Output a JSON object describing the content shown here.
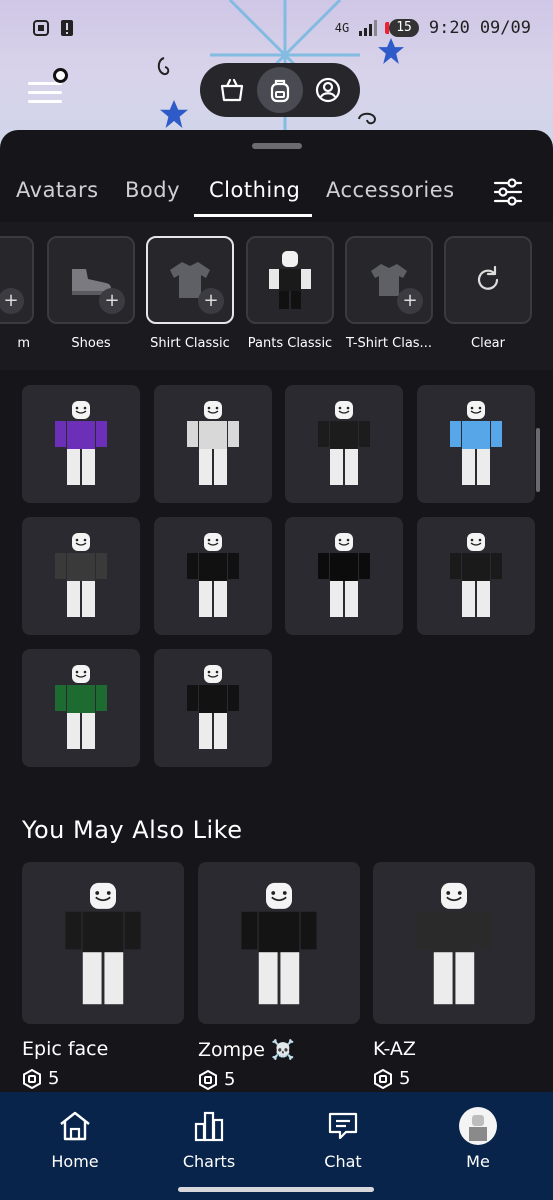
{
  "status": {
    "network": "4G",
    "battery": "15",
    "time": "9:20",
    "date": "09/09"
  },
  "header": {
    "modes": [
      {
        "icon": "shopping-bag-icon"
      },
      {
        "icon": "backpack-icon",
        "active": true
      },
      {
        "icon": "profile-icon"
      }
    ]
  },
  "tabs": {
    "items": [
      "Avatars",
      "Body",
      "Clothing",
      "Accessories"
    ],
    "active": "Clothing"
  },
  "categories": {
    "partial_left_label": "m",
    "items": [
      "Shoes",
      "Shirt Classic",
      "Pants Classic",
      "T-Shirt Clas...",
      "Clear"
    ],
    "active": "Shirt Classic"
  },
  "grid": {
    "shirt_colors": [
      "#6b2fb8",
      "#d8d8d8",
      "#1c1c1c",
      "#56a6e8",
      "#3a3a3a",
      "#111111",
      "#0c0c0c",
      "#1a1a1a",
      "#1e6b32",
      "#121212"
    ]
  },
  "recommendations": {
    "title": "You May Also Like",
    "items": [
      {
        "name": "Epic face",
        "price": "5"
      },
      {
        "name": "Zompe ☠️",
        "price": "5"
      },
      {
        "name": "K-AZ",
        "price": "5"
      }
    ]
  },
  "navbar": {
    "items": [
      {
        "label": "Home",
        "icon": "home-icon"
      },
      {
        "label": "Charts",
        "icon": "charts-icon"
      },
      {
        "label": "Chat",
        "icon": "chat-icon"
      },
      {
        "label": "Me",
        "icon": "avatar"
      }
    ]
  },
  "colors": {
    "accent_nav": "#08244a",
    "sheet": "#16161a",
    "tile": "#2a2a30"
  }
}
